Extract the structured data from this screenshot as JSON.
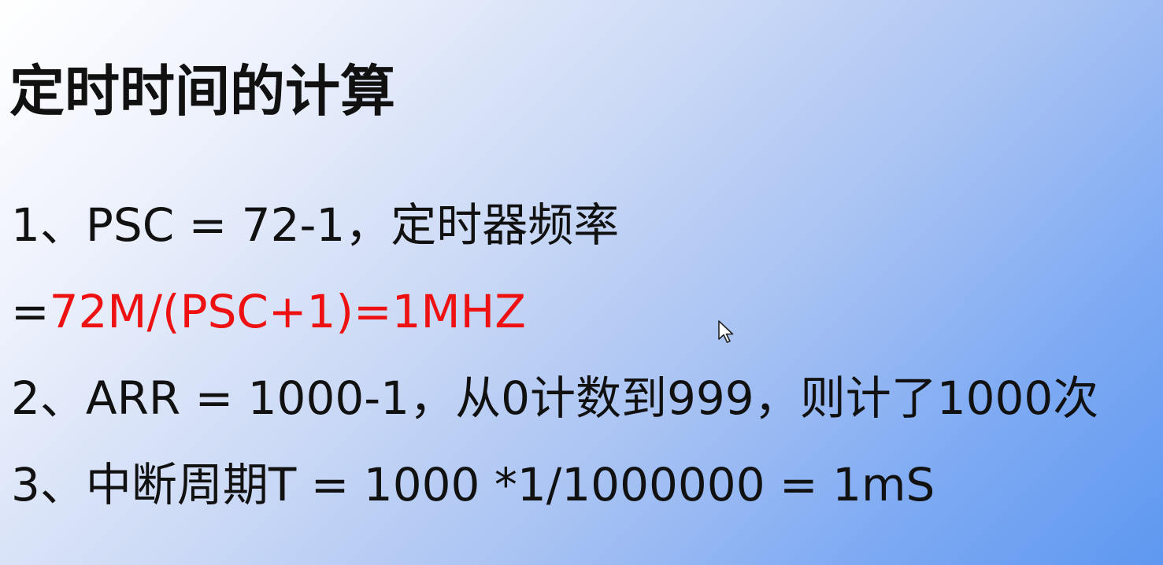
{
  "slide": {
    "title": "定时时间的计算",
    "line1": "1、PSC = 72-1，定时器频率",
    "line2_prefix": "=",
    "line2_formula": "72M/(PSC+1)=1MHZ",
    "line3": "2、ARR = 1000-1，从0计数到999，则计了1000次",
    "line4": "3、中断周期T = 1000 *1/1000000 = 1mS"
  },
  "colors": {
    "formula": "#ee1111",
    "text": "#111111"
  },
  "icons": {
    "cursor": "mouse-pointer-icon"
  }
}
